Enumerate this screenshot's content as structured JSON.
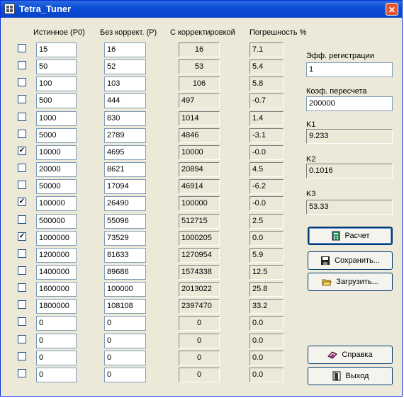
{
  "window": {
    "title": "Tetra_Tuner",
    "close_glyph": "✕"
  },
  "headers": {
    "true_p0": "Истинное (P0)",
    "uncorrected_p": "Без коррект. (P)",
    "corrected": "С корректировкой",
    "error_pct": "Погрешность %"
  },
  "rows": [
    {
      "checked": false,
      "check_glyph": "",
      "p0": "15",
      "p": "16",
      "corr": "16",
      "err": "7.1"
    },
    {
      "checked": false,
      "check_glyph": "",
      "p0": "50",
      "p": "52",
      "corr": "53",
      "err": "5.4"
    },
    {
      "checked": false,
      "check_glyph": "",
      "p0": "100",
      "p": "103",
      "corr": "106",
      "err": "5.8"
    },
    {
      "checked": false,
      "check_glyph": "",
      "p0": "500",
      "p": "444",
      "corr": "497",
      "err": "-0.7"
    },
    {
      "checked": false,
      "check_glyph": "",
      "p0": "1000",
      "p": "830",
      "corr": "1014",
      "err": "1.4"
    },
    {
      "checked": false,
      "check_glyph": "",
      "p0": "5000",
      "p": "2789",
      "corr": "4846",
      "err": "-3.1"
    },
    {
      "checked": true,
      "check_glyph": "✓",
      "p0": "10000",
      "p": "4695",
      "corr": "10000",
      "err": "-0.0"
    },
    {
      "checked": false,
      "check_glyph": "",
      "p0": "20000",
      "p": "8621",
      "corr": "20894",
      "err": "4.5"
    },
    {
      "checked": false,
      "check_glyph": "",
      "p0": "50000",
      "p": "17094",
      "corr": "46914",
      "err": "-6.2"
    },
    {
      "checked": true,
      "check_glyph": "✓",
      "p0": "100000",
      "p": "26490",
      "corr": "100000",
      "err": "-0.0"
    },
    {
      "checked": false,
      "check_glyph": "",
      "p0": "500000",
      "p": "55096",
      "corr": "512715",
      "err": "2.5"
    },
    {
      "checked": true,
      "check_glyph": "✓",
      "p0": "1000000",
      "p": "73529",
      "corr": "1000205",
      "err": "0.0"
    },
    {
      "checked": false,
      "check_glyph": "",
      "p0": "1200000",
      "p": "81633",
      "corr": "1270954",
      "err": "5.9"
    },
    {
      "checked": false,
      "check_glyph": "",
      "p0": "1400000",
      "p": "89686",
      "corr": "1574338",
      "err": "12.5"
    },
    {
      "checked": false,
      "check_glyph": "",
      "p0": "1600000",
      "p": "100000",
      "corr": "2013022",
      "err": "25.8"
    },
    {
      "checked": false,
      "check_glyph": "",
      "p0": "1800000",
      "p": "108108",
      "corr": "2397470",
      "err": "33.2"
    },
    {
      "checked": false,
      "check_glyph": "",
      "p0": "0",
      "p": "0",
      "corr": "0",
      "err": "0.0"
    },
    {
      "checked": false,
      "check_glyph": "",
      "p0": "0",
      "p": "0",
      "corr": "0",
      "err": "0.0"
    },
    {
      "checked": false,
      "check_glyph": "",
      "p0": "0",
      "p": "0",
      "corr": "0",
      "err": "0.0"
    },
    {
      "checked": false,
      "check_glyph": "",
      "p0": "0",
      "p": "0",
      "corr": "0",
      "err": "0.0"
    }
  ],
  "side": {
    "reg_eff_label": "Эфф. регистрации",
    "reg_eff_value": "1",
    "recalc_coef_label": "Коэф. пересчета",
    "recalc_coef_value": "200000",
    "k1_label": "K1",
    "k1_value": "9.233",
    "k2_label": "K2",
    "k2_value": "0.1016",
    "k3_label": "K3",
    "k3_value": "53.33"
  },
  "buttons": {
    "calc": "Расчет",
    "save": "Сохранить...",
    "load": "Загрузить...",
    "help": "Справка",
    "exit": "Выход"
  },
  "icons": {
    "app": "app-grid-icon",
    "calc": "calculator-icon",
    "save": "floppy-disk-icon",
    "load": "open-folder-icon",
    "help": "help-book-icon",
    "exit": "exit-door-icon"
  }
}
